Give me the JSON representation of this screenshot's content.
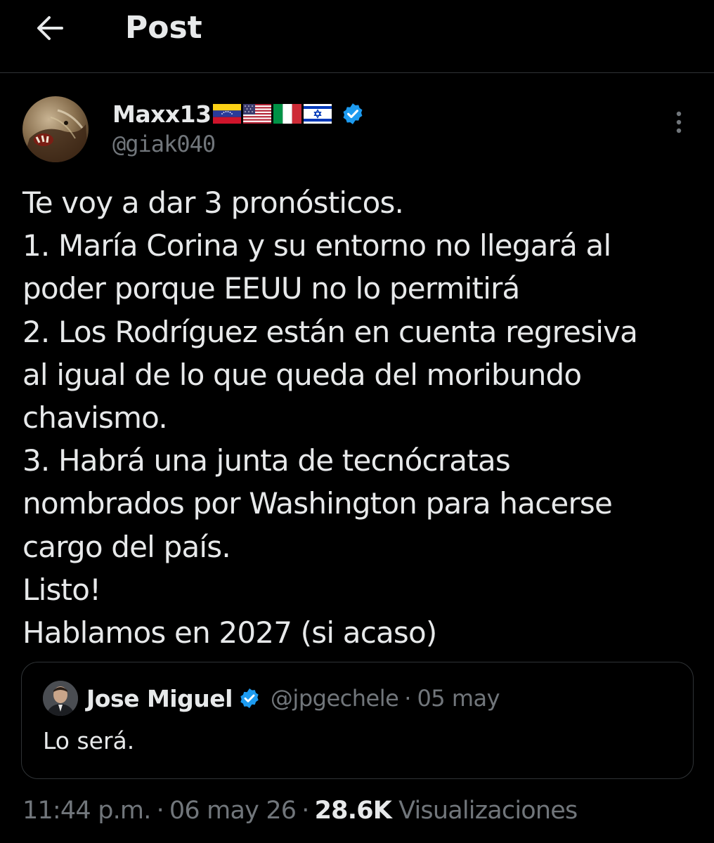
{
  "header": {
    "title": "Post",
    "back_icon": "arrow-left-icon"
  },
  "post": {
    "author": {
      "display_name": "Maxx13",
      "flags": [
        "venezuela-flag",
        "usa-flag",
        "italy-flag",
        "israel-flag"
      ],
      "verified": true,
      "handle": "@giak040"
    },
    "text_lines": [
      "Te voy a dar 3 pronósticos.",
      "1. María Corina y su entorno no llegará al",
      "poder porque EEUU no lo permitirá",
      "2. Los Rodríguez están en cuenta regresiva",
      "al igual de lo que queda del moribundo",
      "chavismo.",
      "3. Habrá una junta de tecnócratas",
      "nombrados por Washington para hacerse",
      "cargo del país.",
      "Listo!",
      "Hablamos en 2027 (si acaso)"
    ],
    "quoted": {
      "display_name": "Jose Miguel",
      "verified": true,
      "handle": "@jpgechele",
      "separator": "·",
      "date": "05 may",
      "text": "Lo será."
    },
    "meta": {
      "time": "11:44 p.m.",
      "separator": "·",
      "date": "06 may 26",
      "views_count": "28.6K",
      "views_label": "Visualizaciones"
    }
  },
  "colors": {
    "background": "#000000",
    "text_primary": "#e7e9ea",
    "text_secondary": "#71767b",
    "border": "#2f3336",
    "verified_blue": "#1d9bf0"
  }
}
